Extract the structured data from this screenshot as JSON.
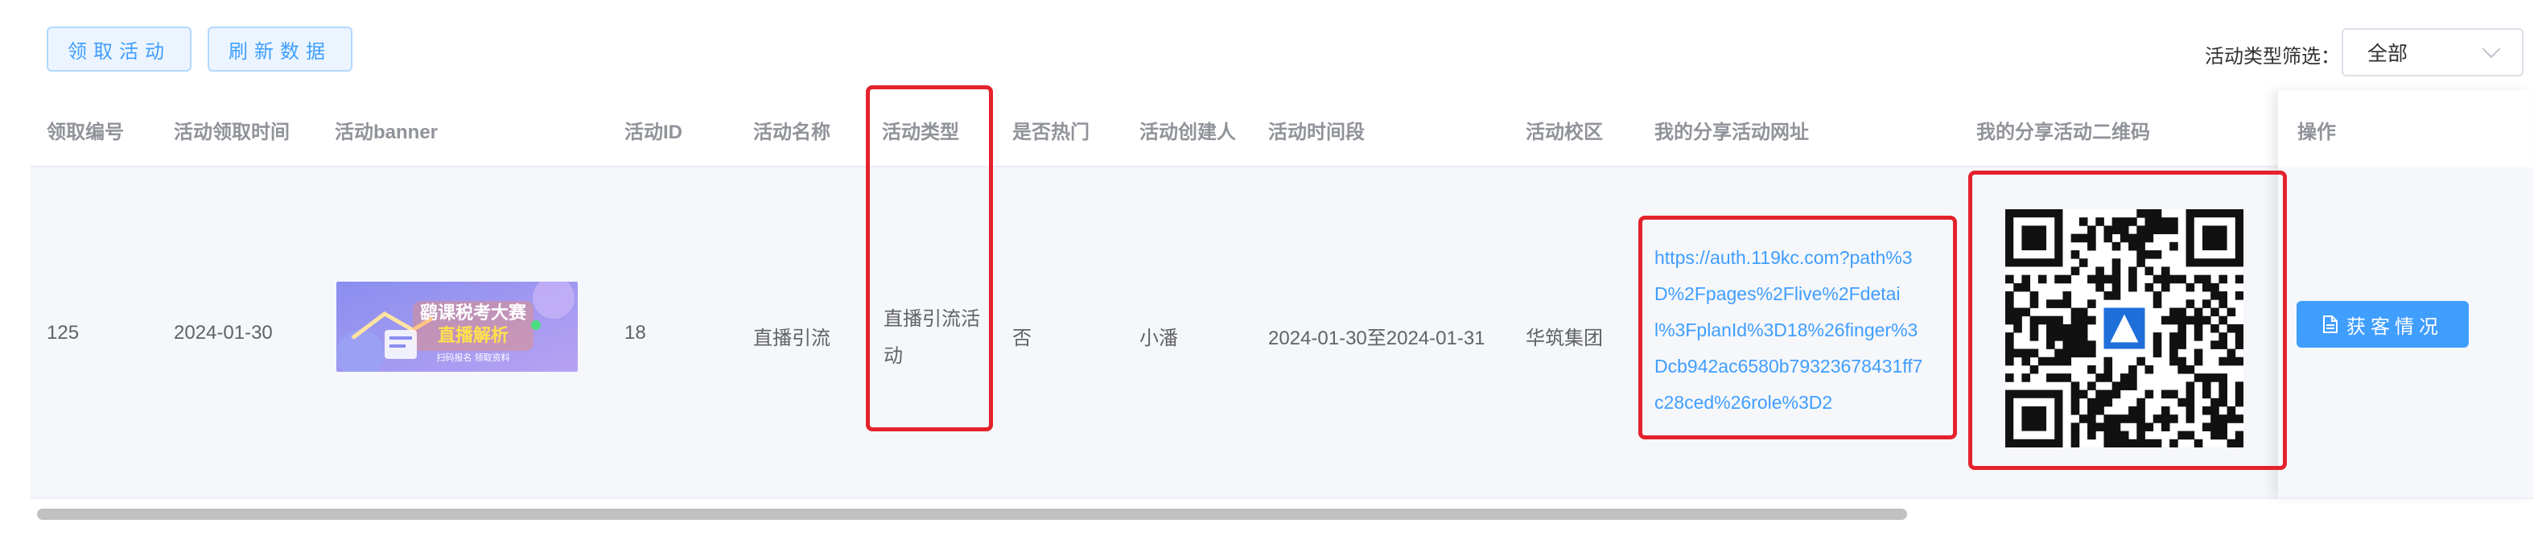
{
  "toolbar": {
    "claim_label": "领取活动",
    "refresh_label": "刷新数据"
  },
  "filter": {
    "label": "活动类型筛选：",
    "selected": "全部"
  },
  "columns": [
    "领取编号",
    "活动领取时间",
    "活动banner",
    "活动ID",
    "活动名称",
    "活动类型",
    "是否热门",
    "活动创建人",
    "活动时间段",
    "活动校区",
    "我的分享活动网址",
    "我的分享活动二维码",
    "操作"
  ],
  "row": {
    "id": "125",
    "date": "2024-01-30",
    "activity_id": "18",
    "name": "直播引流",
    "type_line1": "直播引流活",
    "type_line2": "动",
    "hot": "否",
    "creator": "小潘",
    "period": "2024-01-30至2024-01-31",
    "campus": "华筑集团",
    "share_url_lines": [
      "https://auth.119kc.com?path%3",
      "D%2Fpages%2Flive%2Fdetai",
      "l%3FplanId%3D18%26finger%3",
      "Dcb942ac6580b79323678431ff7",
      "c28ced%26role%3D2"
    ],
    "action_label": "获客情况"
  },
  "banner": {
    "title_line1": "鹞课税考大赛",
    "title_line2": "直播解析",
    "subtitle": "扫码报名 领取资料"
  }
}
